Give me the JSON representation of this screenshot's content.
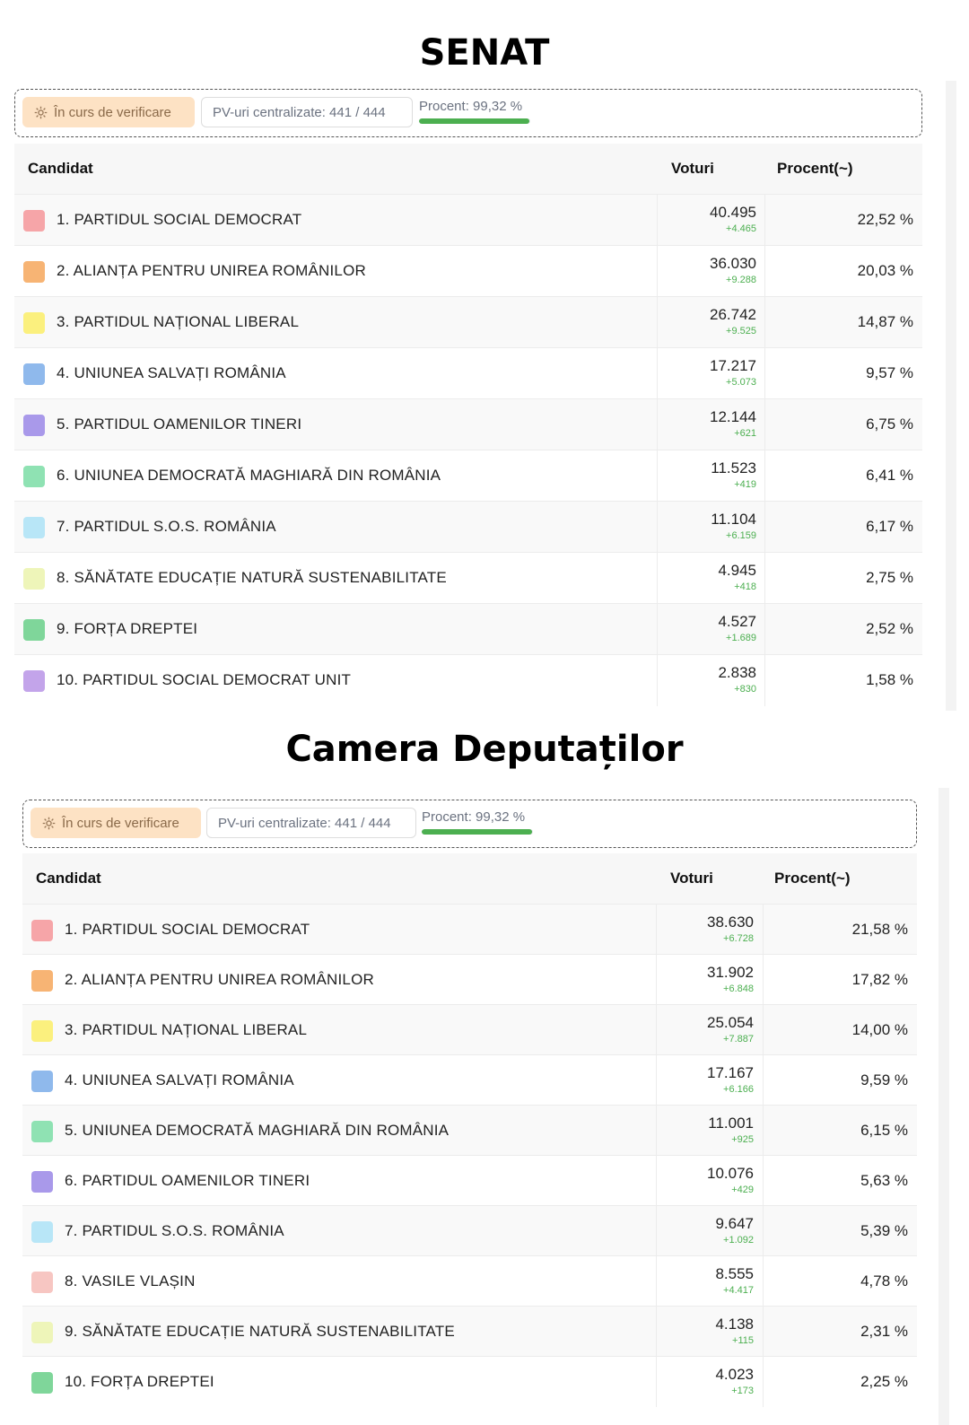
{
  "senat": {
    "title": "SENAT",
    "status": {
      "badge_label": "În curs de verificare",
      "pv_label": "PV-uri centralizate: 441 / 444",
      "percent_label": "Procent: 99,32 %",
      "percent_value": 99.32
    },
    "headers": {
      "candidate": "Candidat",
      "votes": "Voturi",
      "percent": "Procent(~)"
    },
    "rows": [
      {
        "name": "1. PARTIDUL SOCIAL DEMOCRAT",
        "votes": "40.495",
        "delta": "+4.465",
        "pct": "22,52 %",
        "color": "#f6a5a8"
      },
      {
        "name": "2. ALIANȚA PENTRU UNIREA ROMÂNILOR",
        "votes": "36.030",
        "delta": "+9.288",
        "pct": "20,03 %",
        "color": "#f7b474"
      },
      {
        "name": "3. PARTIDUL NAȚIONAL LIBERAL",
        "votes": "26.742",
        "delta": "+9.525",
        "pct": "14,87 %",
        "color": "#fbf07e"
      },
      {
        "name": "4. UNIUNEA SALVAȚI ROMÂNIA",
        "votes": "17.217",
        "delta": "+5.073",
        "pct": "9,57 %",
        "color": "#8fb9ec"
      },
      {
        "name": "5. PARTIDUL OAMENILOR TINERI",
        "votes": "12.144",
        "delta": "+621",
        "pct": "6,75 %",
        "color": "#a999ea"
      },
      {
        "name": "6. UNIUNEA DEMOCRATĂ MAGHIARĂ DIN ROMÂNIA",
        "votes": "11.523",
        "delta": "+419",
        "pct": "6,41 %",
        "color": "#8fe2b3"
      },
      {
        "name": "7. PARTIDUL S.O.S. ROMÂNIA",
        "votes": "11.104",
        "delta": "+6.159",
        "pct": "6,17 %",
        "color": "#b8e6f7"
      },
      {
        "name": "8. SĂNĂTATE EDUCAȚIE NATURĂ SUSTENABILITATE",
        "votes": "4.945",
        "delta": "+418",
        "pct": "2,75 %",
        "color": "#eef5b9"
      },
      {
        "name": "9. FORȚA DREPTEI",
        "votes": "4.527",
        "delta": "+1.689",
        "pct": "2,52 %",
        "color": "#7fd69a"
      },
      {
        "name": "10. PARTIDUL SOCIAL DEMOCRAT UNIT",
        "votes": "2.838",
        "delta": "+830",
        "pct": "1,58 %",
        "color": "#c3a4ea"
      }
    ]
  },
  "camera": {
    "title": "Camera Deputaților",
    "status": {
      "badge_label": "În curs de verificare",
      "pv_label": "PV-uri centralizate: 441 / 444",
      "percent_label": "Procent: 99,32 %",
      "percent_value": 99.32
    },
    "headers": {
      "candidate": "Candidat",
      "votes": "Voturi",
      "percent": "Procent(~)"
    },
    "rows": [
      {
        "name": "1. PARTIDUL SOCIAL DEMOCRAT",
        "votes": "38.630",
        "delta": "+6.728",
        "pct": "21,58 %",
        "color": "#f6a5a8"
      },
      {
        "name": "2. ALIANȚA PENTRU UNIREA ROMÂNILOR",
        "votes": "31.902",
        "delta": "+6.848",
        "pct": "17,82 %",
        "color": "#f7b474"
      },
      {
        "name": "3. PARTIDUL NAȚIONAL LIBERAL",
        "votes": "25.054",
        "delta": "+7.887",
        "pct": "14,00 %",
        "color": "#fbf07e"
      },
      {
        "name": "4. UNIUNEA SALVAȚI ROMÂNIA",
        "votes": "17.167",
        "delta": "+6.166",
        "pct": "9,59 %",
        "color": "#8fb9ec"
      },
      {
        "name": "5. UNIUNEA DEMOCRATĂ MAGHIARĂ DIN ROMÂNIA",
        "votes": "11.001",
        "delta": "+925",
        "pct": "6,15 %",
        "color": "#8fe2b3"
      },
      {
        "name": "6. PARTIDUL OAMENILOR TINERI",
        "votes": "10.076",
        "delta": "+429",
        "pct": "5,63 %",
        "color": "#a999ea"
      },
      {
        "name": "7. PARTIDUL S.O.S. ROMÂNIA",
        "votes": "9.647",
        "delta": "+1.092",
        "pct": "5,39 %",
        "color": "#b8e6f7"
      },
      {
        "name": "8. VASILE VLAȘIN",
        "votes": "8.555",
        "delta": "+4.417",
        "pct": "4,78 %",
        "color": "#f7c6c2"
      },
      {
        "name": "9. SĂNĂTATE EDUCAȚIE NATURĂ SUSTENABILITATE",
        "votes": "4.138",
        "delta": "+115",
        "pct": "2,31 %",
        "color": "#eef5b9"
      },
      {
        "name": "10. FORȚA DREPTEI",
        "votes": "4.023",
        "delta": "+173",
        "pct": "2,25 %",
        "color": "#7fd69a"
      }
    ]
  }
}
